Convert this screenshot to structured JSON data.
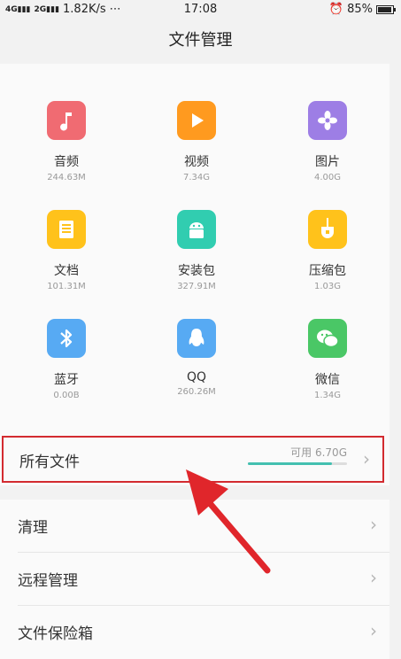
{
  "status_bar": {
    "signal1": "4G",
    "signal2": "2G",
    "speed": "1.82K/s",
    "more": "⋯",
    "time": "17:08",
    "alarm_icon": "alarm-icon",
    "battery": "85%",
    "battery_level": 0.85
  },
  "header": {
    "title": "文件管理"
  },
  "categories": [
    {
      "name": "音频",
      "size": "244.63M",
      "icon": "music-note-icon",
      "color": "#f06b72"
    },
    {
      "name": "视频",
      "size": "7.34G",
      "icon": "play-icon",
      "color": "#ff9a1f"
    },
    {
      "name": "图片",
      "size": "4.00G",
      "icon": "flower-icon",
      "color": "#9d7ee5"
    },
    {
      "name": "文档",
      "size": "101.31M",
      "icon": "document-icon",
      "color": "#ffc21b"
    },
    {
      "name": "安装包",
      "size": "327.91M",
      "icon": "android-icon",
      "color": "#31cdb0"
    },
    {
      "name": "压缩包",
      "size": "1.03G",
      "icon": "zip-icon",
      "color": "#ffc21b"
    },
    {
      "name": "蓝牙",
      "size": "0.00B",
      "icon": "bluetooth-icon",
      "color": "#57aaf3"
    },
    {
      "name": "QQ",
      "size": "260.26M",
      "icon": "qq-penguin-icon",
      "color": "#57aaf3"
    },
    {
      "name": "微信",
      "size": "1.34G",
      "icon": "wechat-icon",
      "color": "#4ac766"
    }
  ],
  "all_files": {
    "label": "所有文件",
    "available": "可用 6.70G",
    "used_fraction": 0.85,
    "highlight_color": "#d32b30",
    "bar_color": "#43c0b0"
  },
  "menu": [
    {
      "label": "清理"
    },
    {
      "label": "远程管理"
    },
    {
      "label": "文件保险箱"
    }
  ]
}
